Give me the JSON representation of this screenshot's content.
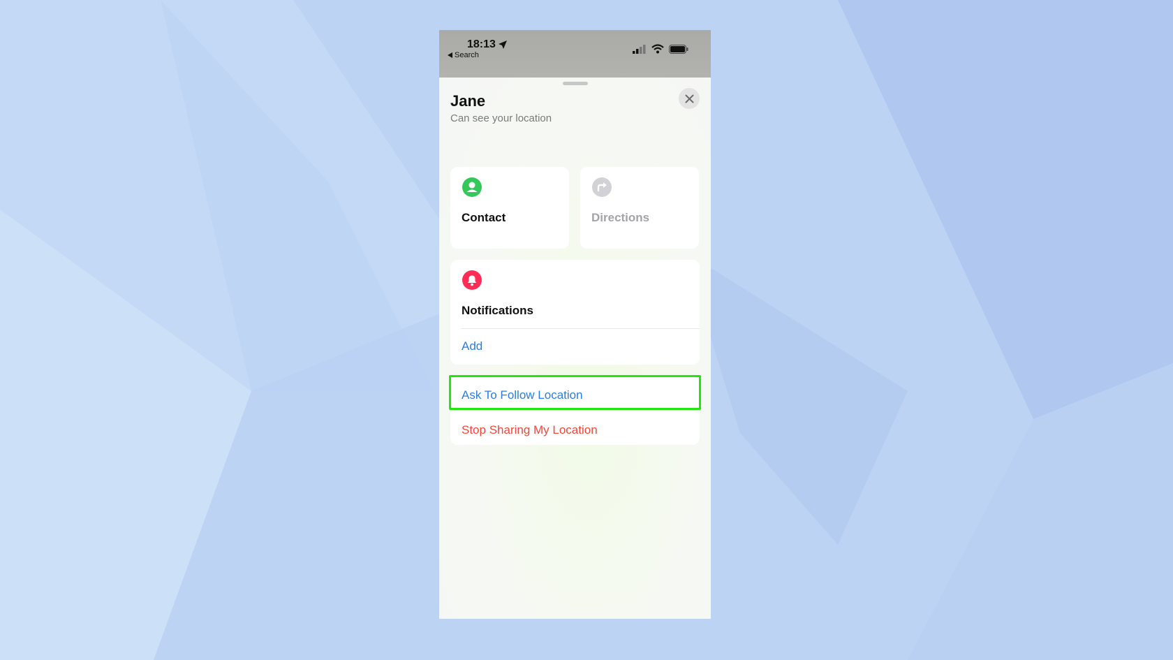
{
  "status_bar": {
    "time": "18:13",
    "back_label": "Search"
  },
  "sheet": {
    "title": "Jane",
    "subtitle": "Can see your location"
  },
  "actions": {
    "contact": {
      "label": "Contact",
      "icon": "person-icon",
      "color": "#34c759"
    },
    "directions": {
      "label": "Directions",
      "icon": "directions-arrow-icon",
      "color": "#d1d1d6"
    }
  },
  "notifications": {
    "label": "Notifications",
    "icon": "bell-icon",
    "icon_color": "#ff2d55",
    "add_label": "Add"
  },
  "location_actions": {
    "ask_to_follow": "Ask To Follow Location",
    "stop_sharing": "Stop Sharing My Location"
  },
  "colors": {
    "link_blue": "#2a7de1",
    "destructive_red": "#f2463a",
    "highlight_green": "#22e60f"
  }
}
